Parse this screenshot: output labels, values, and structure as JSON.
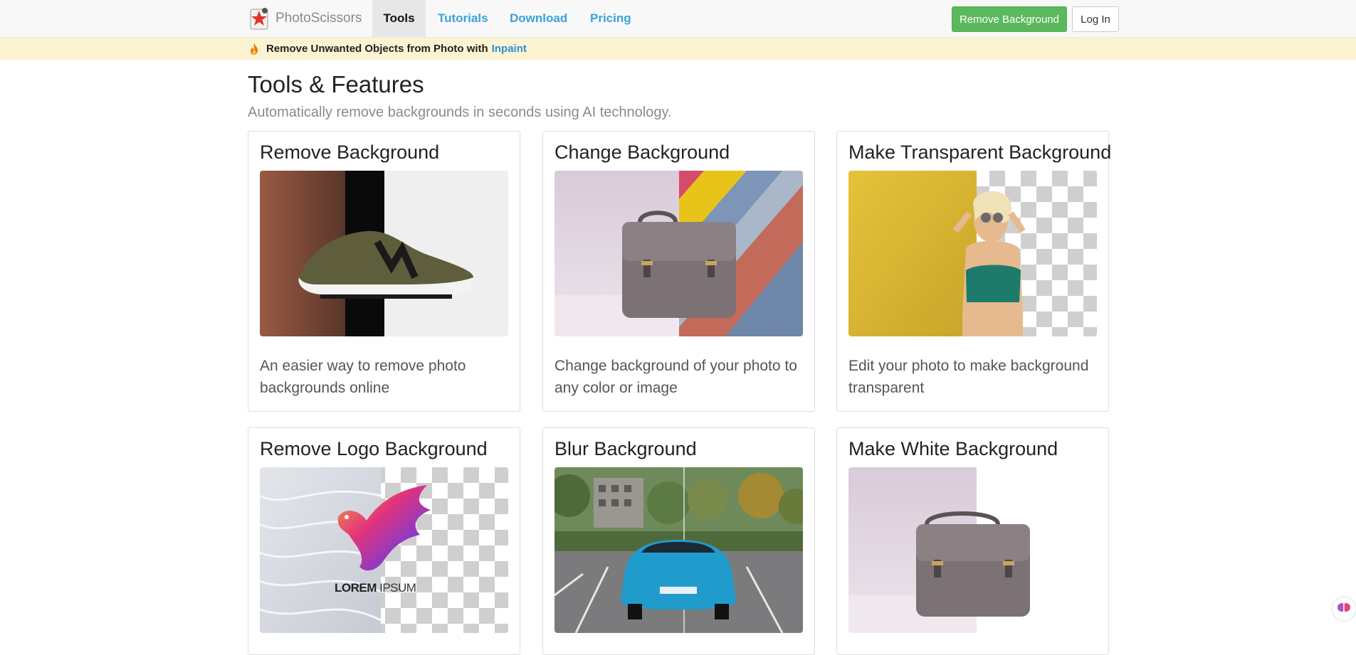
{
  "nav": {
    "brand": "PhotoScissors",
    "links": [
      {
        "label": "Tools",
        "active": true
      },
      {
        "label": "Tutorials",
        "active": false
      },
      {
        "label": "Download",
        "active": false
      },
      {
        "label": "Pricing",
        "active": false
      }
    ],
    "cta_label": "Remove Background",
    "login_label": "Log In"
  },
  "banner": {
    "icon": "flame-icon",
    "text": "Remove Unwanted Objects from Photo with",
    "link": "Inpaint"
  },
  "header": {
    "title": "Tools & Features",
    "subtitle": "Automatically remove backgrounds in seconds using AI technology."
  },
  "cards": [
    {
      "title": "Remove Background",
      "description": "An easier way to remove photo backgrounds online"
    },
    {
      "title": "Change Background",
      "description": "Change background of your photo to any color or image"
    },
    {
      "title": "Make Transparent Background",
      "description": "Edit your photo to make background transparent"
    },
    {
      "title": "Remove Logo Background",
      "description": "",
      "image_text_left": "LOREM",
      "image_text_right": "IPSUM"
    },
    {
      "title": "Blur Background",
      "description": ""
    },
    {
      "title": "Make White Background",
      "description": ""
    }
  ],
  "colors": {
    "accent_link": "#3aa3d9",
    "cta_green": "#5cb85c",
    "banner_bg": "#fcf3d2"
  }
}
